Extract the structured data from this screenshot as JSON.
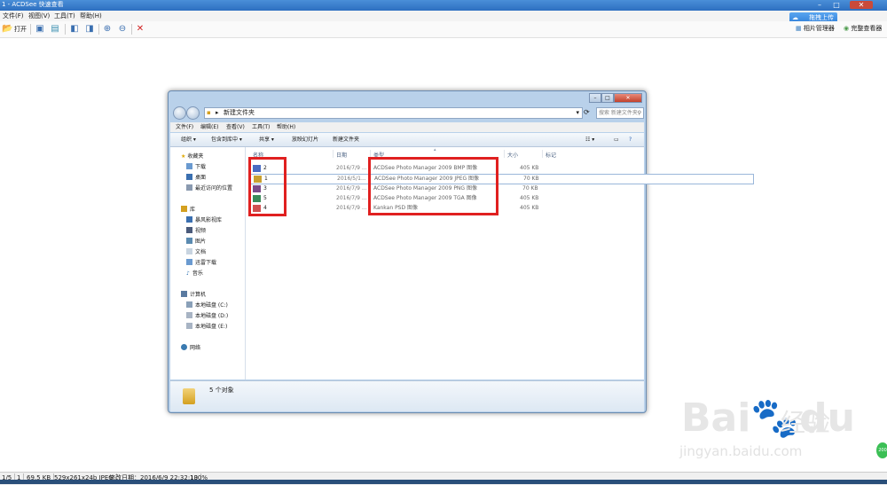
{
  "app": {
    "title": "1 - ACDSee 快速查看",
    "menu": [
      "文件(F)",
      "视图(V)",
      "工具(T)",
      "帮助(H)"
    ],
    "toolbar": {
      "open_label": "打开"
    },
    "upload_label": "拖拽上传",
    "photo_manager_label": "相片管理器",
    "full_viewer_label": "完整查看器"
  },
  "status": {
    "index": "1/5",
    "count": "1",
    "size": "69.5 KB",
    "dimensions": "529x261x24b JPEG",
    "modified": "修改日期：2016/6/9 22:32:13",
    "zoom": "100%"
  },
  "explorer": {
    "address": "新建文件夹",
    "search_placeholder": "搜索 新建文件夹",
    "menu": [
      "文件(F)",
      "编辑(E)",
      "查看(V)",
      "工具(T)",
      "帮助(H)"
    ],
    "commands": [
      "组织 ▾",
      "包含到库中 ▾",
      "共享 ▾",
      "放映幻灯片",
      "新建文件夹"
    ],
    "nav": {
      "favorites_header": "收藏夹",
      "favorites": [
        "下载",
        "桌面",
        "最近访问的位置"
      ],
      "libraries_header": "库",
      "libraries": [
        "暴风影视库",
        "视频",
        "图片",
        "文档",
        "迅雷下载",
        "音乐"
      ],
      "computer_header": "计算机",
      "drives": [
        "本地磁盘 (C:)",
        "本地磁盘 (D:)",
        "本地磁盘 (E:)"
      ],
      "network": "网络"
    },
    "columns": {
      "name": "名称",
      "date": "日期",
      "type": "类型",
      "size": "大小",
      "tags": "标记"
    },
    "files": [
      {
        "name": "2",
        "date": "2016/7/9 ...",
        "type": "ACDSee Photo Manager 2009 BMP 图像",
        "size": "405 KB",
        "icon_color": "#4a6cc2"
      },
      {
        "name": "1",
        "date": "2016/5/1...",
        "type": "ACDSee Photo Manager 2009 JPEG 图像",
        "size": "70 KB",
        "icon_color": "#c9a030"
      },
      {
        "name": "3",
        "date": "2016/7/9 ...",
        "type": "ACDSee Photo Manager 2009 PNG 图像",
        "size": "70 KB",
        "icon_color": "#7a4a8a"
      },
      {
        "name": "5",
        "date": "2016/7/9 ...",
        "type": "ACDSee Photo Manager 2009 TGA 图像",
        "size": "405 KB",
        "icon_color": "#3a8a5a"
      },
      {
        "name": "4",
        "date": "2016/7/9 ...",
        "type": "Kankan PSD 图像",
        "size": "405 KB",
        "icon_color": "#d05050"
      }
    ],
    "details_count": "5 个对象"
  },
  "watermark": {
    "brand": "Bai",
    "brand2": "du",
    "brand_cn": "经验",
    "url": "jingyan.baidu.com"
  },
  "badge": "200",
  "colors": {
    "annotation_red": "#e02020",
    "title_blue": "#2d6fc0"
  }
}
